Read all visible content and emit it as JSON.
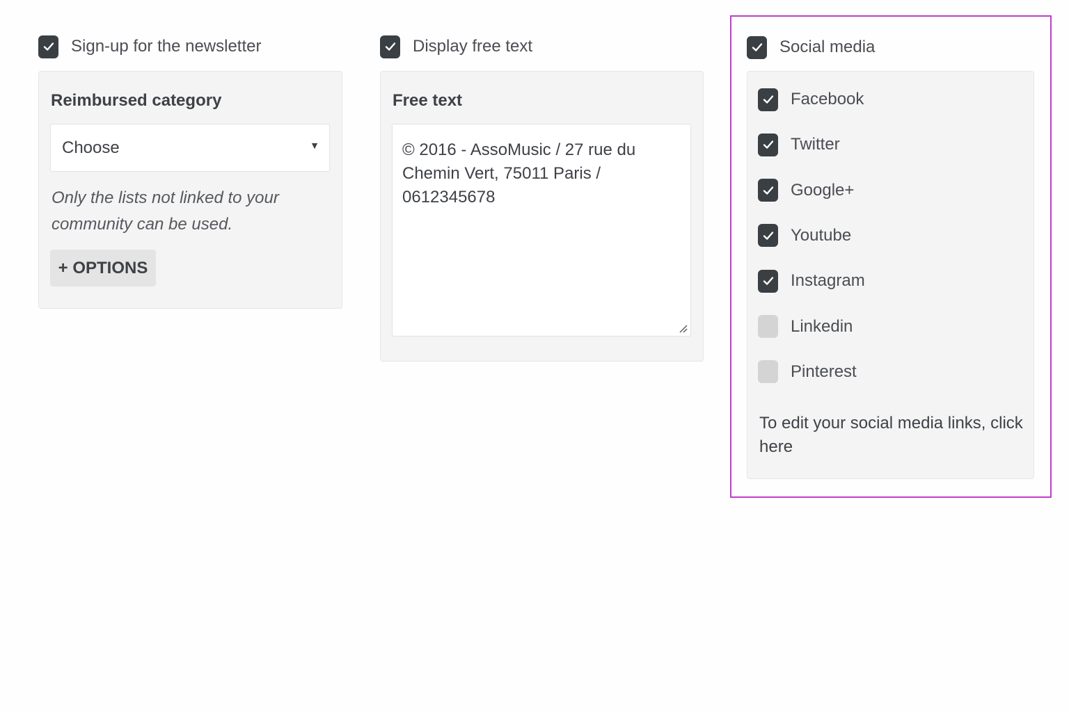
{
  "newsletter": {
    "checkbox_label": "Sign-up for the newsletter",
    "checked": true,
    "panel_title": "Reimbursed category",
    "select_value": "Choose",
    "hint": "Only the lists not linked to your community can be used.",
    "options_button": "+ OPTIONS"
  },
  "free_text": {
    "checkbox_label": "Display free text",
    "checked": true,
    "panel_title": "Free text",
    "textarea_value": "© 2016 - AssoMusic / 27 rue du Chemin Vert, 75011 Paris / 0612345678"
  },
  "social": {
    "checkbox_label": "Social media",
    "checked": true,
    "items": [
      {
        "label": "Facebook",
        "checked": true
      },
      {
        "label": "Twitter",
        "checked": true
      },
      {
        "label": "Google+",
        "checked": true
      },
      {
        "label": "Youtube",
        "checked": true
      },
      {
        "label": "Instagram",
        "checked": true
      },
      {
        "label": "Linkedin",
        "checked": false
      },
      {
        "label": "Pinterest",
        "checked": false
      }
    ],
    "note": "To edit your social media links, click here"
  },
  "icons": {
    "check": "check-icon",
    "dropdown": "chevron-down-icon",
    "resize": "resize-handle-icon"
  },
  "colors": {
    "checkbox_on": "#3a3f44",
    "checkbox_off": "#d4d4d4",
    "highlight_border": "#c23cc8",
    "panel_bg": "#f4f4f5"
  }
}
